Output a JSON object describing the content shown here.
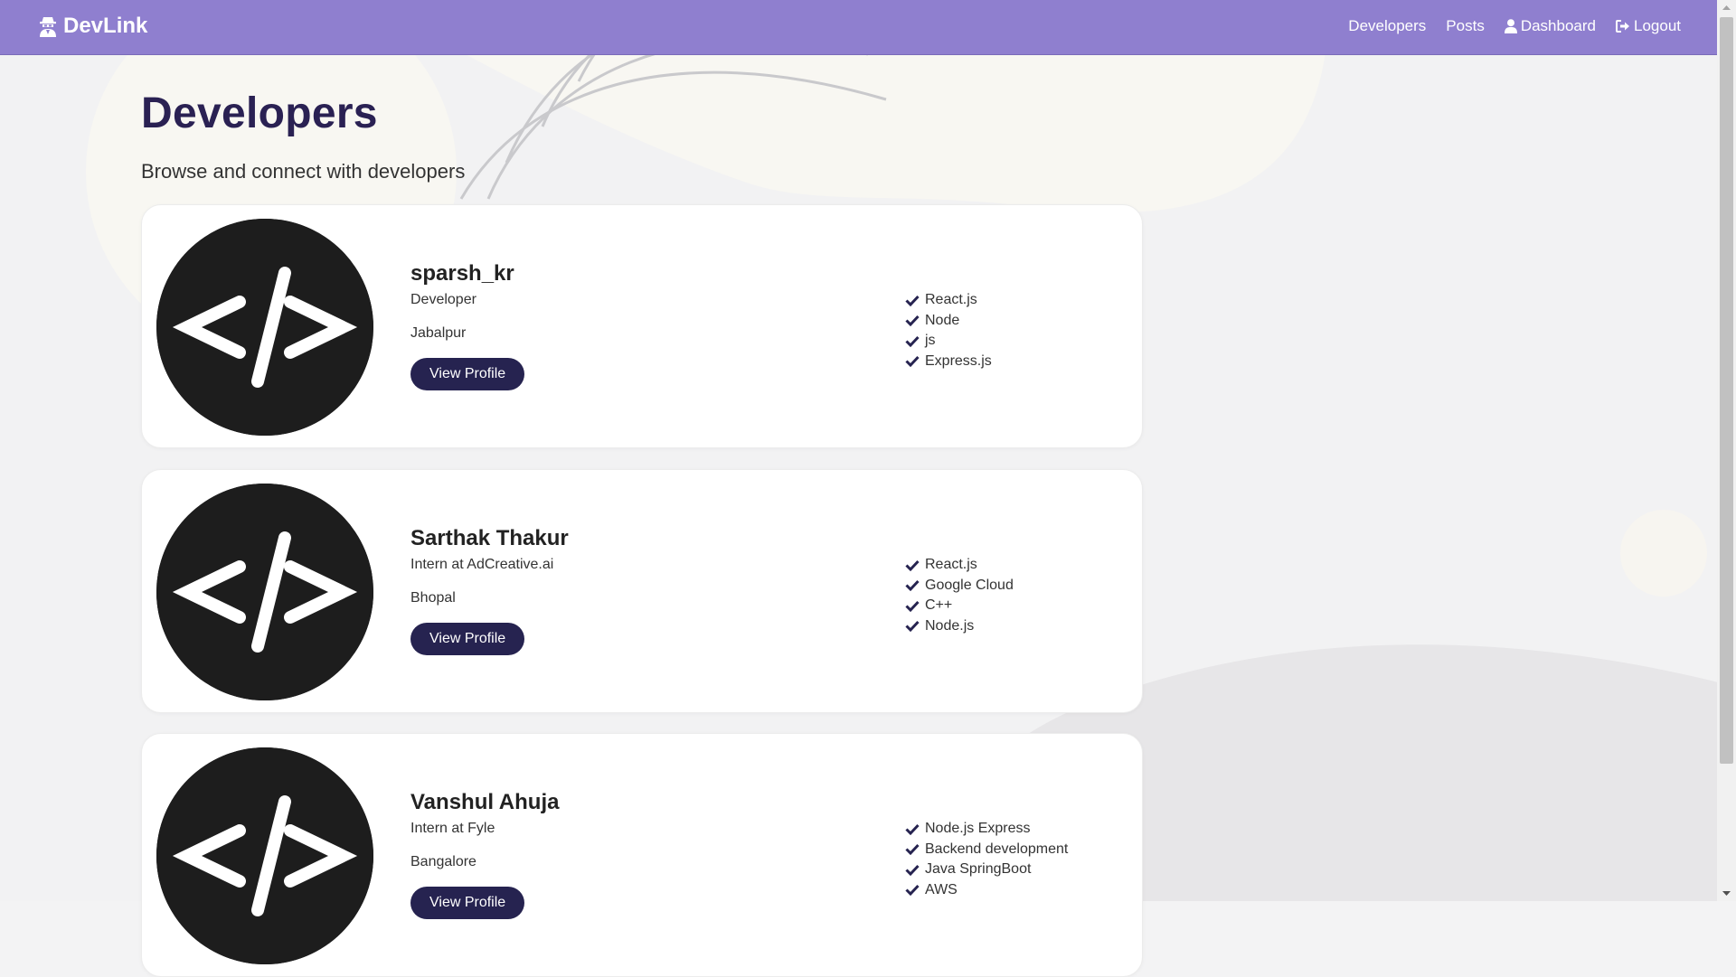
{
  "navbar": {
    "brand": "DevLink",
    "brand_icon": "user-secret-icon",
    "links": [
      {
        "label": "Developers",
        "icon": ""
      },
      {
        "label": "Posts",
        "icon": ""
      },
      {
        "label": "Dashboard",
        "icon": "user-icon"
      },
      {
        "label": "Logout",
        "icon": "sign-out-icon"
      }
    ],
    "color": "#8f7fcf"
  },
  "page": {
    "title": "Developers",
    "lead": "Browse and connect with developers"
  },
  "profiles": [
    {
      "name": "sparsh_kr",
      "status": "Developer",
      "location": "Jabalpur",
      "button": "View Profile",
      "skills": [
        "React.js",
        "Node",
        "js",
        "Express.js"
      ]
    },
    {
      "name": "Sarthak Thakur",
      "status": "Intern at AdCreative.ai",
      "location": "Bhopal",
      "button": "View Profile",
      "skills": [
        "React.js",
        "Google Cloud",
        "C++",
        "Node.js"
      ]
    },
    {
      "name": "Vanshul Ahuja",
      "status": "Intern at Fyle",
      "location": "Bangalore",
      "button": "View Profile",
      "skills": [
        "Node.js Express",
        "Backend development",
        "Java SpringBoot",
        "AWS"
      ]
    }
  ],
  "theme": {
    "primary": "#262350",
    "heading": "#2a2153"
  }
}
